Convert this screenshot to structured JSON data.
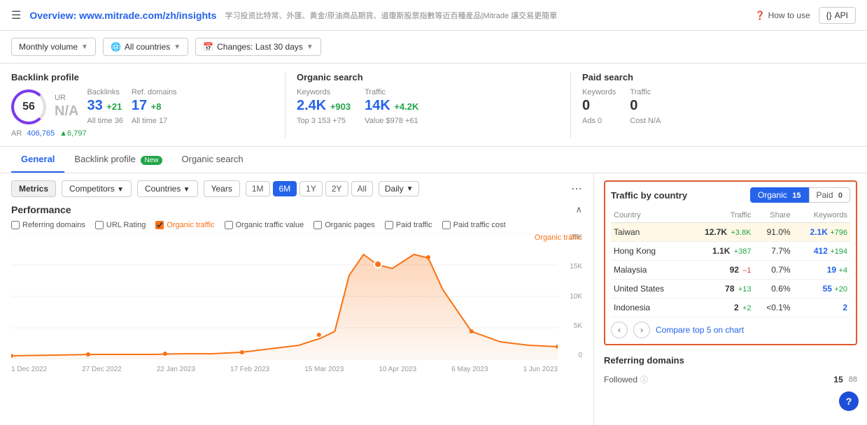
{
  "header": {
    "menu_icon": "≡",
    "title_static": "Overview:",
    "title_url": "www.mitrade.com/zh/insights",
    "subtitle": "学习投资比特常、外匯、黄金/原油商品期貨、道瓊斯股票指數等近百種産品|Mitrade 讓交易更簡單",
    "how_to_use": "How to use",
    "api_label": "API"
  },
  "filters": {
    "volume": "Monthly volume",
    "countries": "All countries",
    "changes": "Changes: Last 30 days"
  },
  "backlink": {
    "section_title": "Backlink profile",
    "dr_label": "DR",
    "dr_value": "56",
    "ur_label": "UR",
    "ur_value": "N/A",
    "backlinks_label": "Backlinks",
    "backlinks_value": "33",
    "backlinks_change": "+21",
    "backlinks_alltime_label": "All time",
    "backlinks_alltime": "36",
    "ref_domains_label": "Ref. domains",
    "ref_domains_value": "17",
    "ref_domains_change": "+8",
    "ref_domains_alltime": "All time  17",
    "ar_label": "AR",
    "ar_value": "406,765",
    "ar_change": "▲6,797"
  },
  "organic_search": {
    "section_title": "Organic search",
    "keywords_label": "Keywords",
    "keywords_value": "2.4K",
    "keywords_change": "+903",
    "keywords_sub": "Top 3  153  +75",
    "traffic_label": "Traffic",
    "traffic_value": "14K",
    "traffic_change": "+4.2K",
    "traffic_sub": "Value  $978  +61"
  },
  "paid_search": {
    "section_title": "Paid search",
    "keywords_label": "Keywords",
    "keywords_value": "0",
    "keywords_sub": "Ads  0",
    "traffic_label": "Traffic",
    "traffic_value": "0",
    "traffic_sub": "Cost  N/A"
  },
  "tabs": {
    "general": "General",
    "backlink_profile": "Backlink profile",
    "backlink_new": "New",
    "organic_search": "Organic search"
  },
  "toolbar": {
    "metrics": "Metrics",
    "competitors": "Competitors",
    "countries": "Countries",
    "years": "Years",
    "time_1m": "1M",
    "time_6m": "6M",
    "time_1y": "1Y",
    "time_2y": "2Y",
    "time_all": "All",
    "daily": "Daily"
  },
  "performance": {
    "title": "Performance",
    "checkboxes": [
      {
        "label": "Referring domains",
        "checked": false,
        "color": "default"
      },
      {
        "label": "URL Rating",
        "checked": false,
        "color": "default"
      },
      {
        "label": "Organic traffic",
        "checked": true,
        "color": "orange"
      },
      {
        "label": "Organic traffic value",
        "checked": false,
        "color": "default"
      },
      {
        "label": "Organic pages",
        "checked": false,
        "color": "default"
      },
      {
        "label": "Paid traffic",
        "checked": false,
        "color": "default"
      },
      {
        "label": "Paid traffic cost",
        "checked": false,
        "color": "default"
      }
    ],
    "chart_legend": "Organic traffic",
    "y_labels": [
      "20K",
      "15K",
      "10K",
      "5K",
      "0"
    ],
    "x_labels": [
      "1 Dec 2022",
      "27 Dec 2022",
      "22 Jan 2023",
      "17 Feb 2023",
      "15 Mar 2023",
      "10 Apr 2023",
      "6 May 2023",
      "1 Jun 2023"
    ]
  },
  "traffic_by_country": {
    "title": "Traffic by country",
    "tab_organic": "Organic",
    "tab_organic_count": "15",
    "tab_paid": "Paid",
    "tab_paid_count": "0",
    "columns": [
      "Country",
      "Traffic",
      "Share",
      "Keywords"
    ],
    "rows": [
      {
        "country": "Taiwan",
        "traffic": "12.7K",
        "change": "+3.8K",
        "share": "91.0%",
        "keywords": "2.1K",
        "kw_change": "+796",
        "highlighted": true
      },
      {
        "country": "Hong Kong",
        "traffic": "1.1K",
        "change": "+387",
        "share": "7.7%",
        "keywords": "412",
        "kw_change": "+194",
        "highlighted": false
      },
      {
        "country": "Malaysia",
        "traffic": "92",
        "change": "–1",
        "share": "0.7%",
        "keywords": "19",
        "kw_change": "+4",
        "highlighted": false
      },
      {
        "country": "United States",
        "traffic": "78",
        "change": "+13",
        "share": "0.6%",
        "keywords": "55",
        "kw_change": "+20",
        "highlighted": false
      },
      {
        "country": "Indonesia",
        "traffic": "2",
        "change": "+2",
        "share": "<0.1%",
        "keywords": "2",
        "kw_change": "",
        "highlighted": false
      }
    ],
    "compare_label": "Compare top 5 on chart"
  },
  "referring_domains": {
    "title": "Referring domains",
    "followed_label": "Followed",
    "followed_value": "15",
    "followed_value2": "88"
  }
}
